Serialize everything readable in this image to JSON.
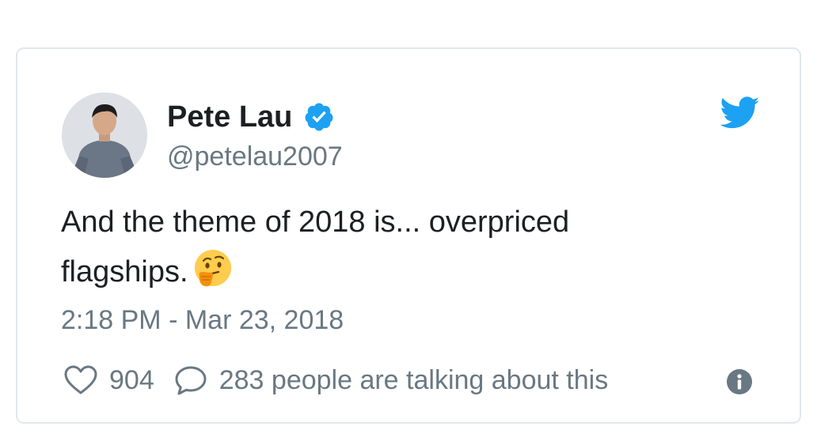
{
  "tweet": {
    "author_name": "Pete Lau",
    "handle": "@petelau2007",
    "text_line1": "And the theme of 2018 is... overpriced",
    "text_line2": "flagships.",
    "timestamp": "2:18 PM - Mar 23, 2018",
    "like_count": "904",
    "conversation_text": "283 people are talking about this"
  },
  "icons": {
    "verified": "verified-badge-icon",
    "bird": "twitter-bird-icon",
    "emoji": "thinking-face-emoji",
    "heart": "heart-icon",
    "reply": "reply-bubble-icon",
    "info": "info-icon"
  },
  "colors": {
    "twitter_blue": "#1da1f2",
    "text_primary": "#1c2022",
    "text_secondary": "#697882",
    "border": "#e1e8ed"
  }
}
